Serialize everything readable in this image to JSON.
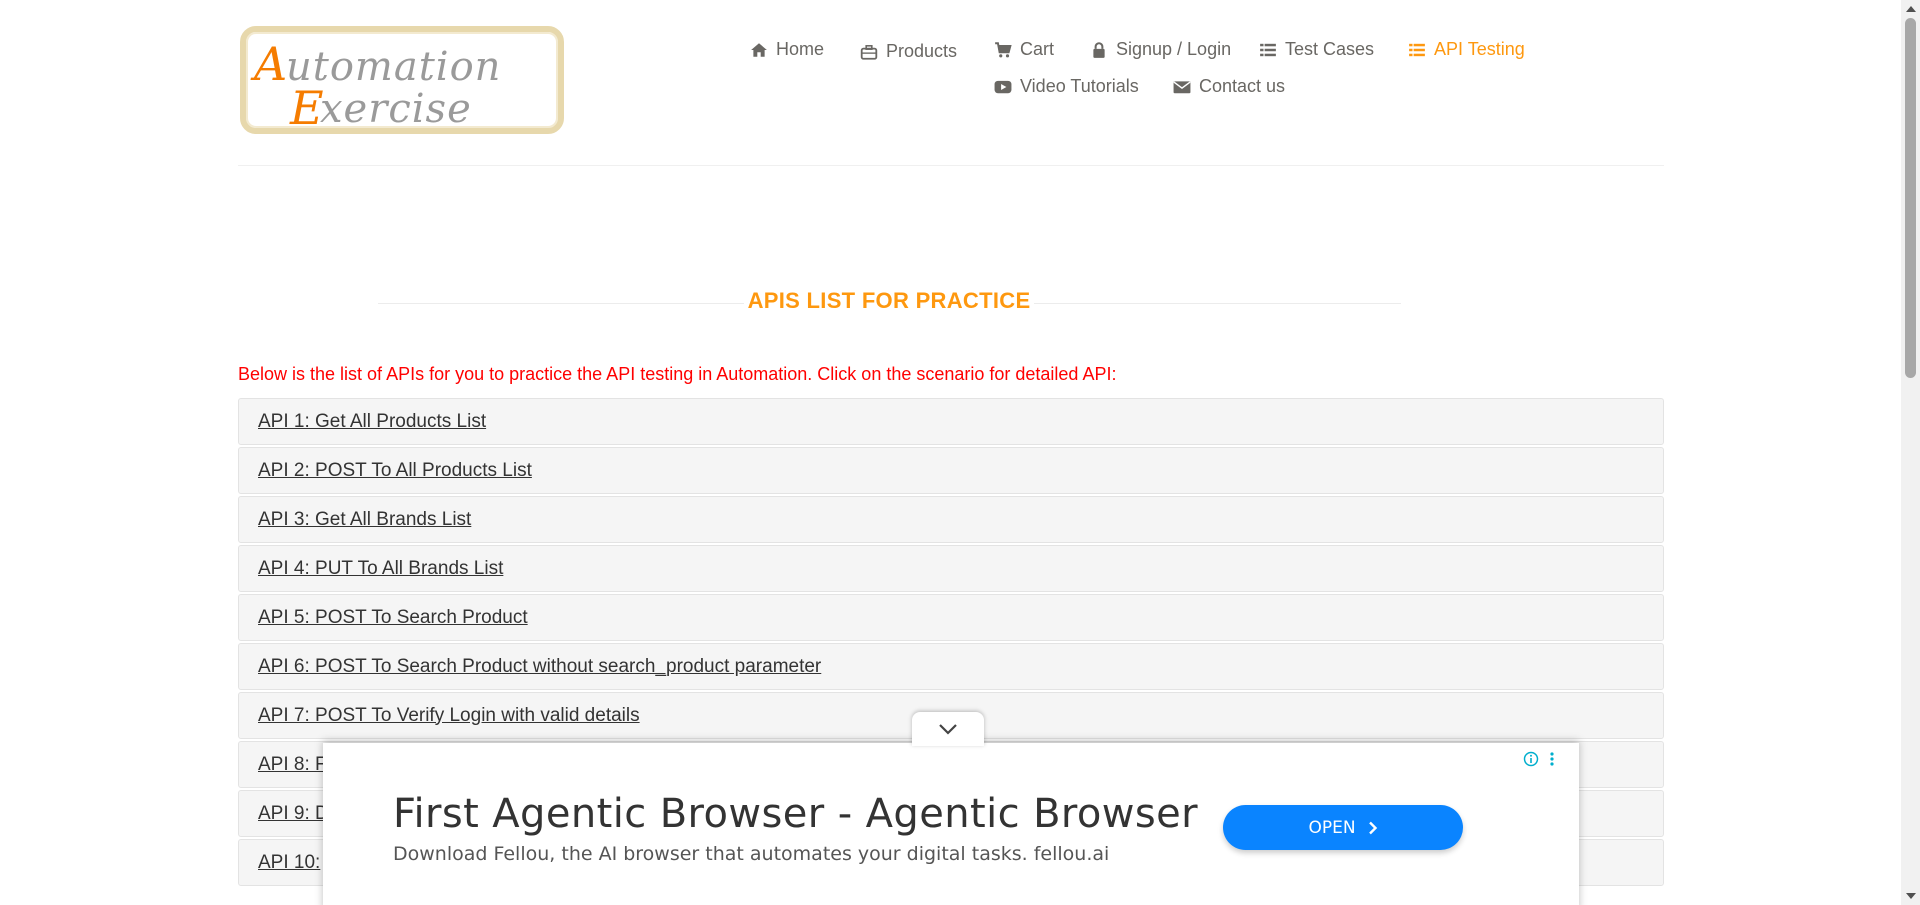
{
  "logo": {
    "line1": "Automation",
    "line2": "Exercise"
  },
  "nav": {
    "home": "Home",
    "products": "Products",
    "cart": "Cart",
    "signup_login": "Signup / Login",
    "test_cases": "Test Cases",
    "api_testing": "API Testing",
    "video_tutorials": "Video Tutorials",
    "contact_us": "Contact us"
  },
  "section": {
    "title": "APIS LIST FOR PRACTICE",
    "intro": "Below is the list of APIs for you to practice the API testing in Automation. Click on the scenario for detailed API:"
  },
  "apis": [
    "API 1: Get All Products List",
    "API 2: POST To All Products List",
    "API 3: Get All Brands List",
    "API 4: PUT To All Brands List",
    "API 5: POST To Search Product",
    "API 6: POST To Search Product without search_product parameter",
    "API 7: POST To Verify Login with valid details",
    "API 8: F",
    "API 9: D",
    "API 10:"
  ],
  "ad": {
    "headline": "First Agentic Browser - Agentic Browser",
    "description": "Download Fellou, the AI browser that automates your digital tasks. fellou.ai",
    "button_label": "OPEN"
  },
  "colors": {
    "accent": "#fe980f",
    "intro_red": "#ff0000",
    "ad_button": "#0a84ff"
  }
}
